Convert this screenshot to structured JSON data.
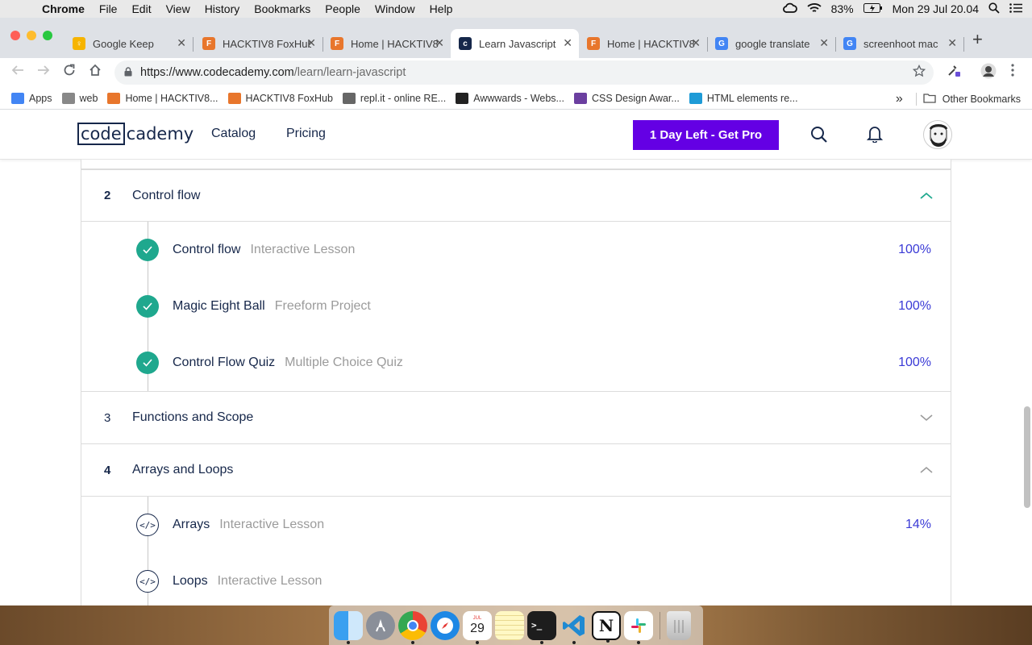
{
  "menubar": {
    "app": "Chrome",
    "items": [
      "File",
      "Edit",
      "View",
      "History",
      "Bookmarks",
      "People",
      "Window",
      "Help"
    ],
    "battery": "83%",
    "datetime": "Mon 29 Jul  20.04"
  },
  "tabs": [
    {
      "title": "Google Keep",
      "color": "#f6b400",
      "glyph": "♀"
    },
    {
      "title": "HACKTIV8 FoxHub",
      "color": "#e8762c",
      "glyph": "F"
    },
    {
      "title": "Home | HACKTIV8",
      "color": "#e8762c",
      "glyph": "F"
    },
    {
      "title": "Learn Javascript",
      "color": "#16274a",
      "glyph": "c",
      "active": true
    },
    {
      "title": "Home | HACKTIV8",
      "color": "#e8762c",
      "glyph": "F"
    },
    {
      "title": "google translate",
      "color": "#4285f4",
      "glyph": "G"
    },
    {
      "title": "screenhoot mac",
      "color": "#4285f4",
      "glyph": "G"
    }
  ],
  "address": {
    "host": "https://www.codecademy.com",
    "path": "/learn/learn-javascript"
  },
  "bookmarks": [
    {
      "label": "Apps",
      "color": "#4285f4"
    },
    {
      "label": "web",
      "color": "#888888"
    },
    {
      "label": "Home | HACKTIV8...",
      "color": "#e8762c"
    },
    {
      "label": "HACKTIV8 FoxHub",
      "color": "#e8762c"
    },
    {
      "label": "repl.it - online RE...",
      "color": "#666666"
    },
    {
      "label": "Awwwards - Webs...",
      "color": "#222222"
    },
    {
      "label": "CSS Design Awar...",
      "color": "#6b3fa0"
    },
    {
      "label": "HTML elements re...",
      "color": "#1e9bd7"
    }
  ],
  "bookmarks_more": "»",
  "other_bookmarks": "Other Bookmarks",
  "site": {
    "logo_box": "code",
    "logo_rest": "cademy",
    "nav": [
      "Catalog",
      "Pricing"
    ],
    "pro_button": "1 Day Left - Get Pro"
  },
  "modules": [
    {
      "number": "2",
      "title": "Control flow",
      "expanded": true,
      "lessons": [
        {
          "title": "Control flow",
          "type": "Interactive Lesson",
          "progress": "100%",
          "complete": true
        },
        {
          "title": "Magic Eight Ball",
          "type": "Freeform Project",
          "progress": "100%",
          "complete": true
        },
        {
          "title": "Control Flow Quiz",
          "type": "Multiple Choice Quiz",
          "progress": "100%",
          "complete": true
        }
      ]
    },
    {
      "number": "3",
      "title": "Functions and Scope",
      "expanded": false,
      "lessons": []
    },
    {
      "number": "4",
      "title": "Arrays and Loops",
      "expanded": true,
      "lessons": [
        {
          "title": "Arrays",
          "type": "Interactive Lesson",
          "progress": "14%",
          "complete": false
        },
        {
          "title": "Loops",
          "type": "Interactive Lesson",
          "progress": "",
          "complete": false
        }
      ]
    }
  ],
  "dock_date": "29",
  "colors": {
    "accent": "#6400e4",
    "check": "#1fa88e",
    "progress": "#3a3ad6",
    "navy": "#16274a"
  }
}
